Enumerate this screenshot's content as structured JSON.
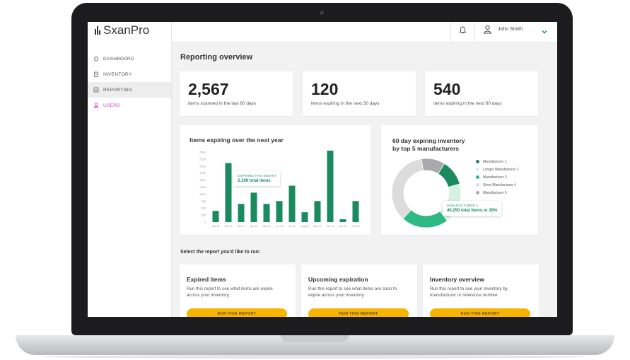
{
  "app": {
    "name": "SxanPro"
  },
  "sidebar": {
    "items": [
      {
        "label": "DASHBOARD",
        "icon": "home-icon"
      },
      {
        "label": "INVENTORY",
        "icon": "clipboard-icon"
      },
      {
        "label": "REPORTING",
        "icon": "report-icon",
        "active": true
      },
      {
        "label": "USERS",
        "icon": "user-icon",
        "color": "#d63cc7"
      }
    ]
  },
  "header": {
    "user_name": "John Smith"
  },
  "page": {
    "title": "Reporting overview"
  },
  "stats": [
    {
      "value": "2,567",
      "label": "items scanned in the last 60 days"
    },
    {
      "value": "120",
      "label": "items expiring in the next 30 days"
    },
    {
      "value": "540",
      "label": "items expiring in the next 60 days"
    }
  ],
  "bar_chart": {
    "title": "Items expiring over the next year",
    "tooltip": {
      "line1": "EXPIRING THIS MONTH",
      "line2": "2,109 total items"
    }
  },
  "donut_chart": {
    "title_line1": "60 day expiring inventory",
    "title_line2": "by top 5 manufacturers",
    "tooltip": {
      "line1": "MANUFACTURER 4",
      "line2": "40,250 total items or 36%"
    }
  },
  "chart_data": [
    {
      "type": "bar",
      "title": "Items expiring over the next year",
      "ylim": [
        0,
        2500
      ],
      "yticks": [
        0,
        250,
        500,
        750,
        1000,
        1250,
        1500,
        1750,
        2000,
        2250,
        2500
      ],
      "categories": [
        "Jan 19",
        "Feb 19",
        "Mar 19",
        "Apr 19",
        "May 19",
        "Jun 19",
        "Jul 19",
        "Aug 19",
        "Sep 19",
        "Oct 19",
        "Nov 19",
        "Dec 19"
      ],
      "values": [
        400,
        2109,
        650,
        1050,
        650,
        750,
        1300,
        350,
        750,
        2550,
        100,
        750
      ],
      "color": "#1a8a5f",
      "grid": false
    },
    {
      "type": "pie",
      "title": "60 day expiring inventory by top 5 manufacturers",
      "labels": [
        "Manufacturer 1",
        "Longer Manufacturer 2",
        "Manufacturer 3",
        "Short Manufacturer 4",
        "Manufacturer 5"
      ],
      "values": [
        12,
        19,
        22,
        36,
        11
      ],
      "colors": [
        "#1a8a5f",
        "#d7f0e4",
        "#2eb883",
        "#dcdcdc",
        "#a9aaad"
      ],
      "legend_position": "right"
    }
  ],
  "reports": {
    "prompt": "Select the report you'd like to run:",
    "items": [
      {
        "title": "Expired items",
        "description": "Run this report to see what items are expire across your inventory.",
        "button": "RUN THIS REPORT"
      },
      {
        "title": "Upcoming expiration",
        "description": "Run this report to see what items are soon to expire across your inventory.",
        "button": "RUN THIS REPORT"
      },
      {
        "title": "Inventory overview",
        "description": "Run this report to see your inventory by manufacturer or reference number.",
        "button": "RUN THIS REPORT"
      }
    ]
  }
}
